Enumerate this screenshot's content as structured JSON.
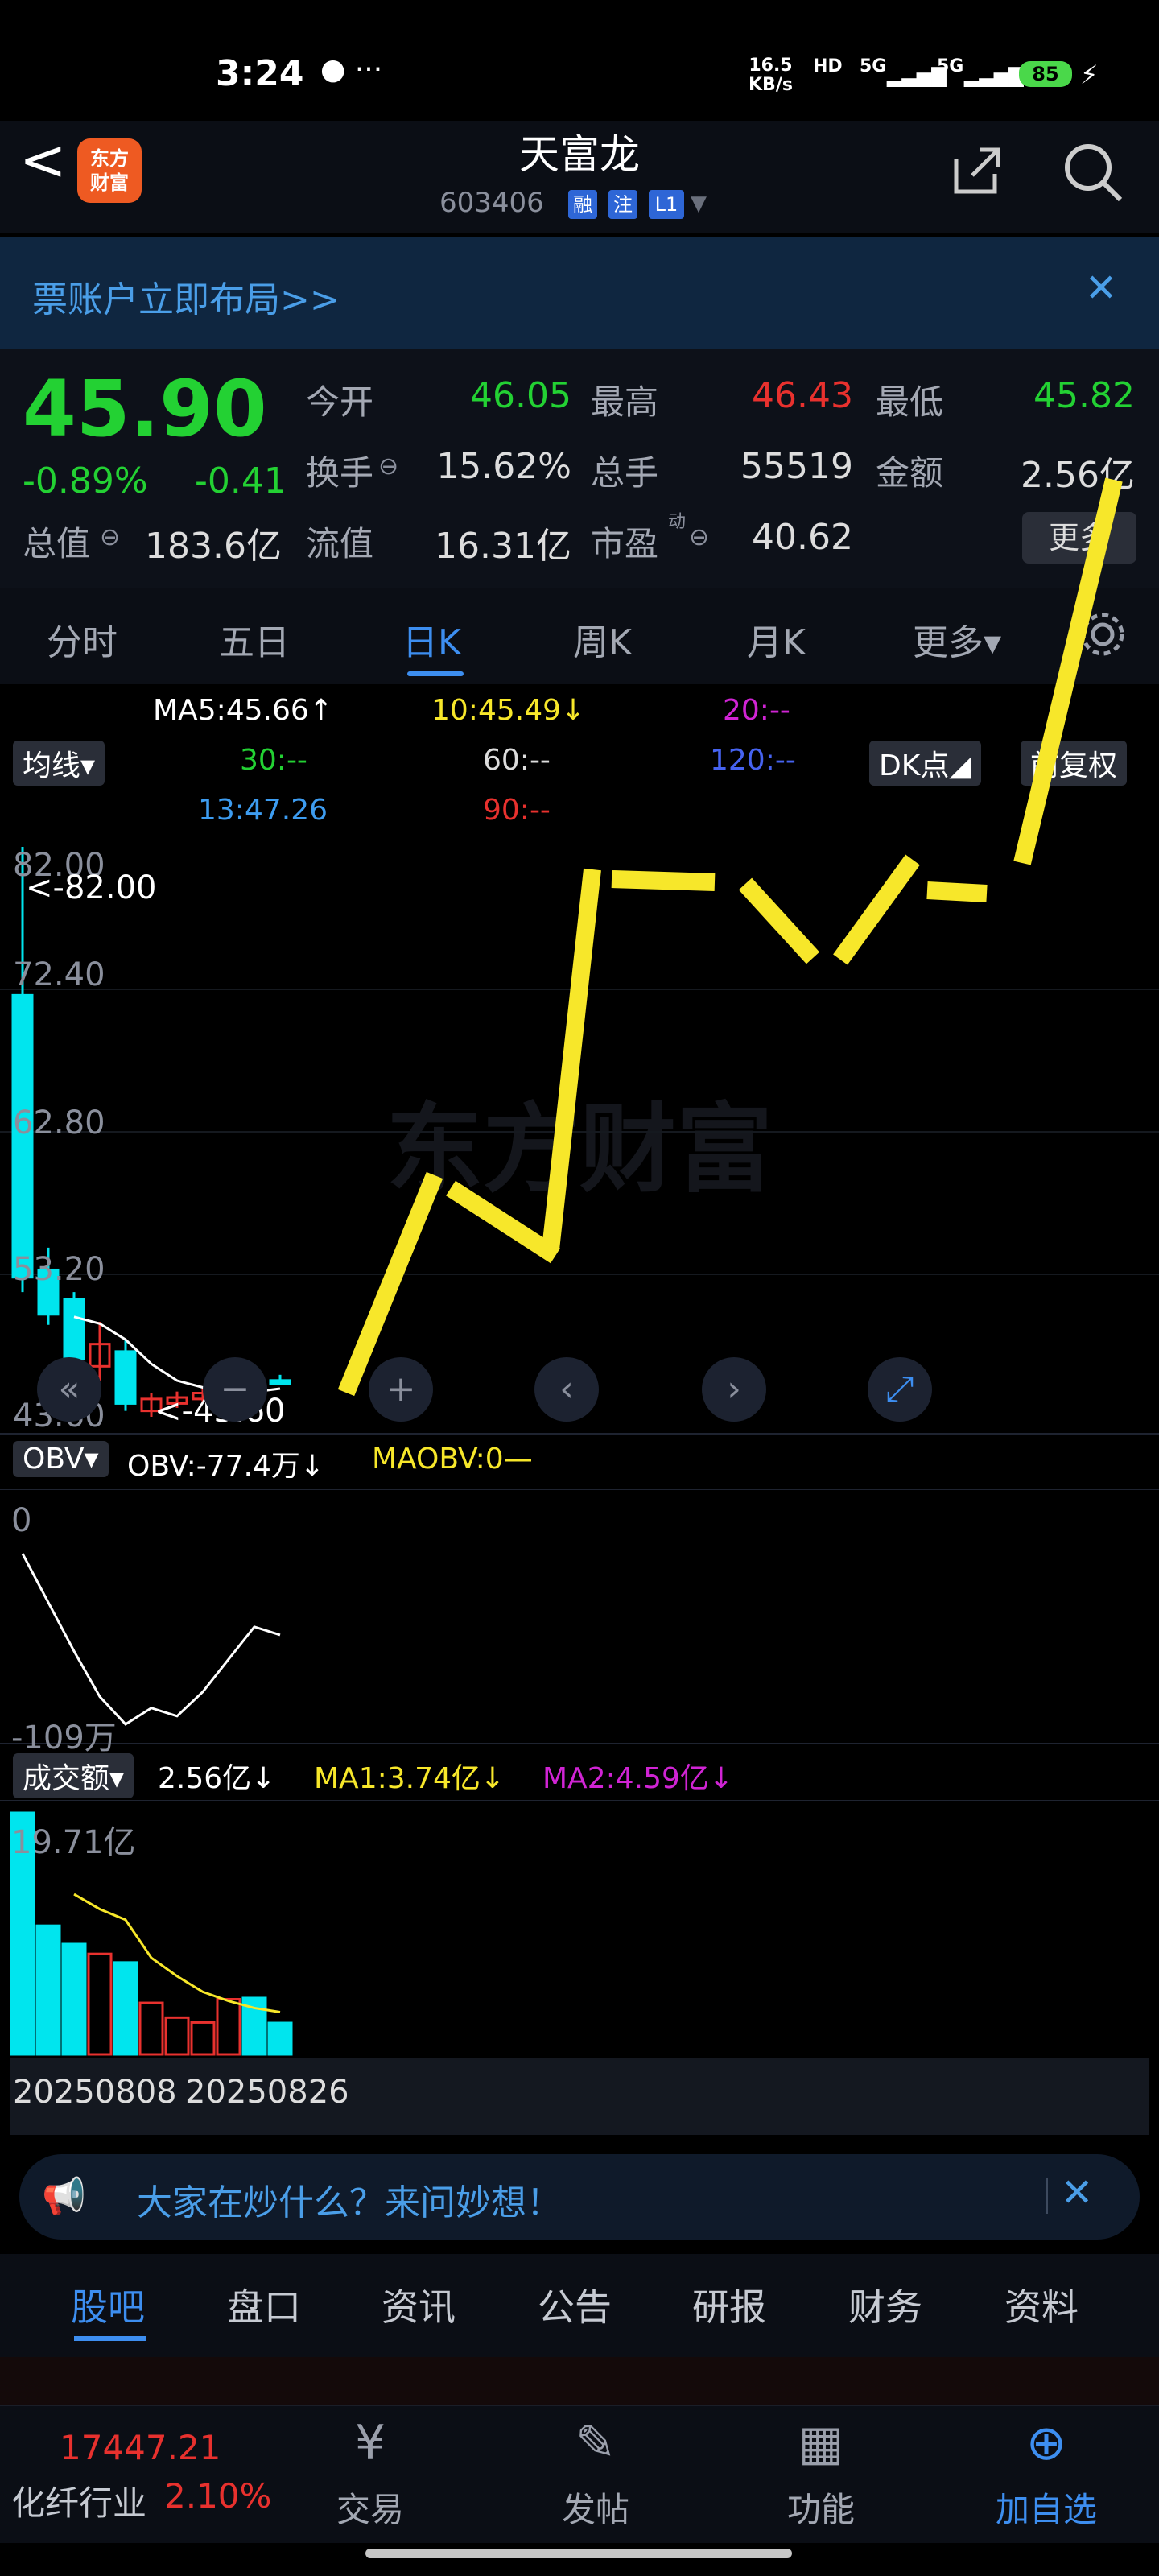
{
  "status_bar": {
    "time": "3:24",
    "dots": "● ···",
    "net_speed": "16.5",
    "net_unit": "KB/s",
    "hd": "HD",
    "sig1": "5G",
    "sig2": "5G",
    "battery": "85"
  },
  "header": {
    "back": "<",
    "logo": "东方\n财富",
    "title": "天富龙",
    "code": "603406",
    "tags": [
      "融",
      "注",
      "L1"
    ],
    "dropdown": "▼"
  },
  "banner": {
    "text": "票账户立即布局>>",
    "close": "✕"
  },
  "quote": {
    "price": "45.90",
    "change_pct": "-0.89%",
    "change": "-0.41",
    "open_label": "今开",
    "open": "46.05",
    "high_label": "最高",
    "high": "46.43",
    "low_label": "最低",
    "low": "45.82",
    "turnover_label": "换手",
    "turnover": "15.62%",
    "volume_label": "总手",
    "volume": "55519",
    "amount_label": "金额",
    "amount": "2.56亿",
    "mcap_label": "总值",
    "mcap": "183.6亿",
    "float_label": "流值",
    "float": "16.31亿",
    "pe_label": "市盈",
    "pe_sup": "动",
    "pe": "40.62",
    "more": "更多"
  },
  "tabs": [
    "分时",
    "五日",
    "日K",
    "周K",
    "月K",
    "更多▾"
  ],
  "chart_header": {
    "ma5": "MA5:45.66↑",
    "ma10": "10:45.49↓",
    "ma20": "20:--",
    "ma30": "30:--",
    "ma60": "60:--",
    "ma120": "120:--",
    "ma250": "13:47.26",
    "ma90": "90:--",
    "indicator": "均线▾",
    "dk": "DK点◢",
    "adjust": "前复权"
  },
  "price_axis": [
    "82.00",
    "72.40",
    "62.80",
    "53.20",
    "43.60"
  ],
  "annotations": {
    "max": "<-82.00",
    "min": "<-43.60"
  },
  "watermark": "东方财富",
  "obv": {
    "label": "OBV▾",
    "value": "OBV:-77.4万↓",
    "ma": "MAOBV:0—",
    "top": "0",
    "bottom": "-109万"
  },
  "volume": {
    "label": "成交额▾",
    "value": "2.56亿↓",
    "ma1": "MA1:3.74亿↓",
    "ma2": "MA2:4.59亿↓",
    "top": "19.71亿"
  },
  "dates": [
    "20250808",
    "20250826"
  ],
  "ask": {
    "icon": "📢",
    "text": "大家在炒什么？来问妙想！",
    "close": "✕"
  },
  "bottom_tabs": [
    "股吧",
    "盘口",
    "资讯",
    "公告",
    "研报",
    "财务",
    "资料"
  ],
  "bottom_nav": {
    "index_value": "17447.21",
    "index_name": "化纤行业",
    "index_change": "2.10%",
    "items": [
      {
        "icon": "¥",
        "label": "交易"
      },
      {
        "icon": "✎",
        "label": "发帖"
      },
      {
        "icon": "▦",
        "label": "功能"
      },
      {
        "icon": "⊕",
        "label": "加自选"
      }
    ]
  },
  "colors": {
    "up": "#e8312e",
    "down": "#23d133",
    "accent": "#3d8ef0",
    "candle_down": "#00e5ee",
    "scribble": "#f7e72a"
  },
  "chart_data": {
    "type": "candlestick",
    "ylim": [
      43.6,
      82.0
    ],
    "yticks": [
      82.0,
      72.4,
      62.8,
      53.2,
      43.6
    ],
    "candles": [
      {
        "open": 72.0,
        "close": 53.0,
        "high": 82.0,
        "low": 52.0,
        "dir": "down"
      },
      {
        "open": 53.5,
        "close": 50.5,
        "high": 55.0,
        "low": 49.8,
        "dir": "down"
      },
      {
        "open": 51.5,
        "close": 47.5,
        "high": 52.0,
        "low": 47.0,
        "dir": "down"
      },
      {
        "open": 47.0,
        "close": 48.5,
        "high": 50.0,
        "low": 46.0,
        "dir": "up"
      },
      {
        "open": 48.0,
        "close": 44.5,
        "high": 48.8,
        "low": 44.0,
        "dir": "down"
      },
      {
        "open": 44.0,
        "close": 44.8,
        "high": 45.2,
        "low": 43.6,
        "dir": "up"
      },
      {
        "open": 44.5,
        "close": 44.9,
        "high": 45.3,
        "low": 44.2,
        "dir": "up"
      },
      {
        "open": 44.8,
        "close": 45.2,
        "high": 45.6,
        "low": 44.6,
        "dir": "up"
      },
      {
        "open": 45.5,
        "close": 45.6,
        "high": 45.9,
        "low": 45.1,
        "dir": "up"
      },
      {
        "open": 45.8,
        "close": 45.9,
        "high": 46.2,
        "low": 45.4,
        "dir": "down"
      },
      {
        "open": 46.05,
        "close": 45.9,
        "high": 46.43,
        "low": 45.82,
        "dir": "down"
      }
    ],
    "obv": [
      0,
      -30,
      -60,
      -88,
      -105,
      -95,
      -100,
      -85,
      -65,
      -45,
      -50
    ],
    "obv_ylim": [
      -109,
      0
    ],
    "volume": [
      19.71,
      10.5,
      9.0,
      8.2,
      7.5,
      4.2,
      3.0,
      2.6,
      4.5,
      4.6,
      2.56
    ],
    "volume_ylim": [
      0,
      19.71
    ]
  }
}
